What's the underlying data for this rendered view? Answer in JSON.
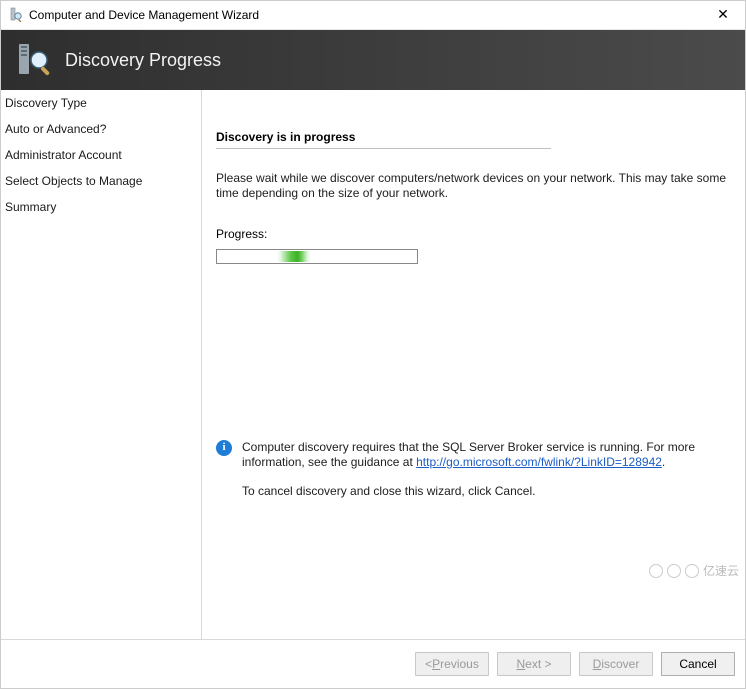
{
  "window": {
    "title": "Computer and Device Management Wizard"
  },
  "banner": {
    "title": "Discovery Progress"
  },
  "nav": {
    "items": [
      {
        "label": "Discovery Type"
      },
      {
        "label": "Auto or Advanced?"
      },
      {
        "label": "Administrator Account"
      },
      {
        "label": "Select Objects to Manage"
      },
      {
        "label": "Summary"
      }
    ]
  },
  "content": {
    "heading": "Discovery is in progress",
    "description": "Please wait while we discover computers/network devices on your network. This may take some time depending on the size of your network.",
    "progress_label": "Progress:",
    "info_prefix": "Computer discovery requires that the SQL Server Broker service is running. For more information, see the guidance at ",
    "info_link_text": "http://go.microsoft.com/fwlink/?LinkID=128942",
    "info_link_url": "http://go.microsoft.com/fwlink/?LinkID=128942",
    "info_suffix": ".",
    "cancel_hint": "To cancel discovery and close this wizard, click Cancel."
  },
  "footer": {
    "previous_prefix": "< ",
    "previous_u": "P",
    "previous_rest": "revious",
    "next_u": "N",
    "next_rest": "ext >",
    "discover_u": "D",
    "discover_rest": "iscover",
    "cancel": "Cancel"
  },
  "watermark": {
    "text": "亿速云"
  }
}
